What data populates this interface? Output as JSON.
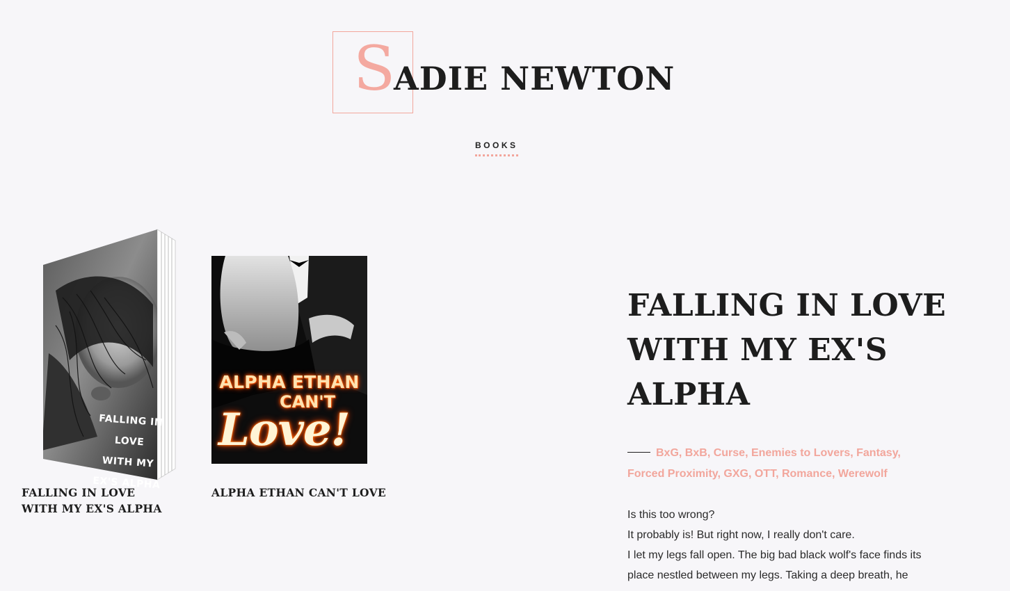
{
  "site": {
    "logo_initial": "S",
    "logo_rest": "ADIE NEWTON"
  },
  "nav": {
    "books_label": "BOOKS"
  },
  "books": [
    {
      "title": "FALLING IN LOVE WITH MY EX'S ALPHA",
      "cover_text": [
        "FALLING IN LOVE",
        "WITH MY",
        "EX'S ALPHA"
      ]
    },
    {
      "title": "ALPHA ETHAN CAN'T LOVE",
      "cover_text": [
        "ALPHA ETHAN",
        "CAN'T",
        "Love!"
      ]
    }
  ],
  "detail": {
    "title": "FALLING IN LOVE WITH MY EX'S ALPHA",
    "genres": [
      "BxG",
      "BxB",
      "Curse",
      "Enemies to Lovers",
      "Fantasy",
      "Forced Proximity",
      "GXG",
      "OTT",
      "Romance",
      "Werewolf"
    ],
    "excerpt": [
      "Is this too wrong?",
      "It probably is! But right now, I really don't care.",
      "I let my legs fall open. The big bad black wolf's face finds its place nestled between my legs. Taking a deep breath, he"
    ]
  },
  "colors": {
    "accent": "#f2a69c",
    "background": "#f7f6f9",
    "text": "#1d1d1d"
  }
}
